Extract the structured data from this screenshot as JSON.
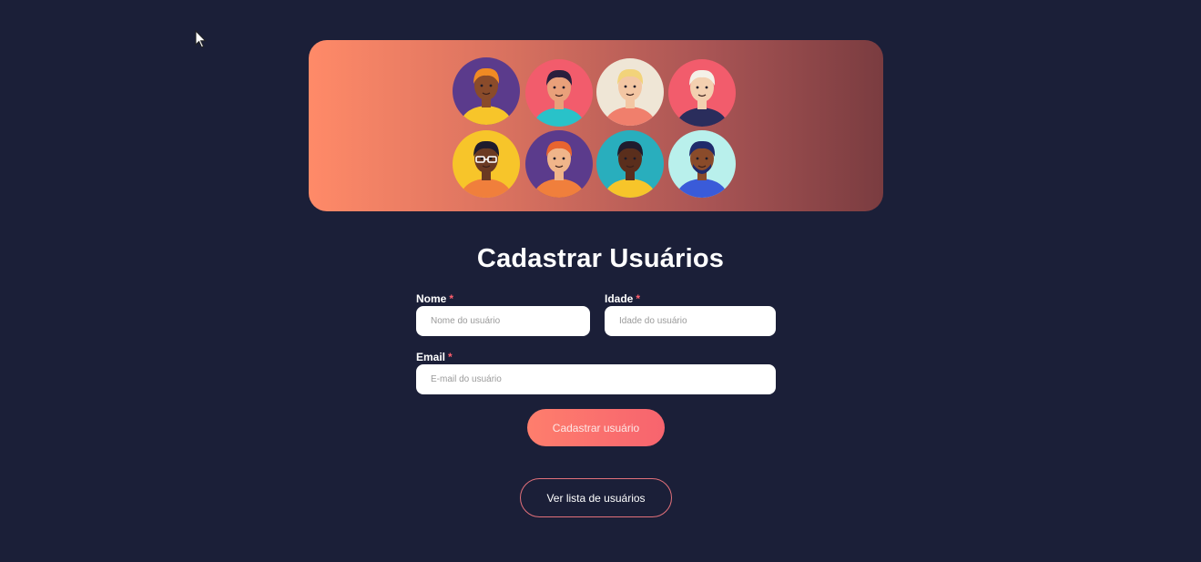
{
  "page": {
    "title": "Cadastrar Usuários"
  },
  "banner": {
    "avatars": [
      {
        "name": "avatar-woman-curly-orange",
        "bg": "#5b3b8c",
        "skin": "#8a4b2a",
        "hair": "#f08a24",
        "shirt": "#f7c52a"
      },
      {
        "name": "avatar-woman-cap",
        "bg": "#f25c6c",
        "skin": "#e9a07a",
        "hair": "#2a1f3d",
        "shirt": "#29c2c9"
      },
      {
        "name": "avatar-woman-blonde",
        "bg": "#efe6d6",
        "skin": "#f3c6a3",
        "hair": "#f2d37a",
        "shirt": "#f07f6c"
      },
      {
        "name": "avatar-man-white-hair",
        "bg": "#f25c6c",
        "skin": "#f3d0b0",
        "hair": "#f4f1e8",
        "shirt": "#2a2d5c"
      },
      {
        "name": "avatar-man-glasses",
        "bg": "#f7c52a",
        "skin": "#6b3a22",
        "hair": "#1f1b2d",
        "shirt": "#f07f3c"
      },
      {
        "name": "avatar-man-redhead",
        "bg": "#5b3b8c",
        "skin": "#f0b58a",
        "hair": "#e8642f",
        "shirt": "#f07f3c"
      },
      {
        "name": "avatar-man-hoodie",
        "bg": "#29aebd",
        "skin": "#5a2e1c",
        "hair": "#1f1b2d",
        "shirt": "#f7c52a"
      },
      {
        "name": "avatar-man-beard",
        "bg": "#b9f0ec",
        "skin": "#8a4b2a",
        "hair": "#1f2a6b",
        "shirt": "#3a5bd9"
      }
    ]
  },
  "form": {
    "nome": {
      "label": "Nome",
      "required": "*",
      "placeholder": "Nome do usuário",
      "value": ""
    },
    "idade": {
      "label": "Idade",
      "required": "*",
      "placeholder": "Idade do usuário",
      "value": ""
    },
    "email": {
      "label": "Email",
      "required": "*",
      "placeholder": "E-mail do usuário",
      "value": ""
    },
    "submit_label": "Cadastrar usuário"
  },
  "footer": {
    "list_link_label": "Ver lista de usuários"
  }
}
